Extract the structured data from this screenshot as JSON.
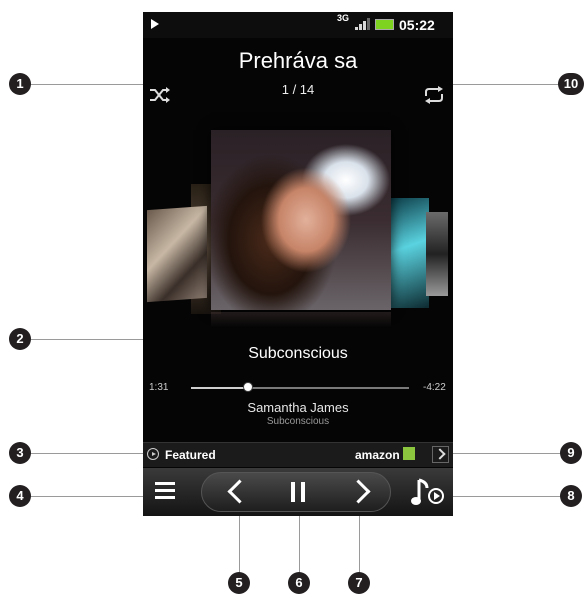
{
  "status_bar": {
    "network": "3G",
    "time": "05:22",
    "battery_color": "#7ed321"
  },
  "header": {
    "title": "Prehráva sa",
    "counter": "1 / 14"
  },
  "track": {
    "song": "Subconscious",
    "artist": "Samantha James",
    "album": "Subconscious",
    "elapsed": "1:31",
    "remaining": "-4:22",
    "progress_fraction": 0.26
  },
  "featured_bar": {
    "featured_label": "Featured",
    "store_label": "amazon"
  },
  "icons": {
    "shuffle": "shuffle-icon",
    "repeat": "repeat-icon",
    "menu": "menu-icon",
    "previous": "previous-icon",
    "pause": "pause-icon",
    "next": "next-icon",
    "library": "music-library-icon",
    "featured": "play-circle-icon",
    "expand": "chevron-right-icon"
  },
  "callouts": [
    "1",
    "2",
    "3",
    "4",
    "5",
    "6",
    "7",
    "8",
    "9",
    "10"
  ]
}
